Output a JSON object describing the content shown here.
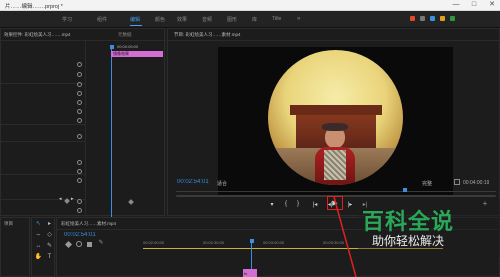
{
  "titlebar": {
    "title": "片……编辑…….prproj *",
    "minimize": "—",
    "maximize": "□",
    "close": "✕"
  },
  "menu": {
    "items": [
      {
        "label": "学习",
        "active": false
      },
      {
        "label": "组件",
        "active": false
      },
      {
        "label": "编辑",
        "active": true
      },
      {
        "label": "颜色",
        "active": false
      },
      {
        "label": "效果",
        "active": false
      },
      {
        "label": "音频",
        "active": false
      },
      {
        "label": "图形",
        "active": false
      },
      {
        "label": "库",
        "active": false
      },
      {
        "label": "Title",
        "active": false
      }
    ],
    "more": "»"
  },
  "effect_controls": {
    "tab_label": "效果控件: 彩虹绘美人习…….mp4",
    "tab2_label": "元数据",
    "timecode": "00:00:05:00",
    "clip_label": "镜像效果"
  },
  "program_monitor": {
    "tab_label": "节目: 彩虹绘美人习……素材.mp4",
    "timecode_current": "00:02:54:01",
    "fit_label": "适合",
    "quality_label": "完整",
    "timecode_duration": "00:04:00:19"
  },
  "transport": {
    "mark_in": "▾",
    "mark_out": "{",
    "clear": "}",
    "goto_in": "|◂",
    "step_back": "◂|",
    "play": "▶",
    "step_forward": "|▸",
    "goto_out": "▸|",
    "add": "+"
  },
  "timeline": {
    "project_label": "项目",
    "seq_tab": "彩虹绘美人习……素材.mp4",
    "timecode": "00:02:54:01",
    "ruler": [
      "00:02:00:00",
      "00:02:30:00",
      "00:03:00:00",
      "00:03:30:00",
      "00:04:00:00"
    ],
    "clip_label": "fx"
  },
  "watermark": {
    "title": "百科全说",
    "subtitle": "助你轻松解决"
  },
  "colors": {
    "accent_blue": "#3a8fe0",
    "clip_pink": "#d36fd2",
    "highlight_red": "#e02020"
  }
}
